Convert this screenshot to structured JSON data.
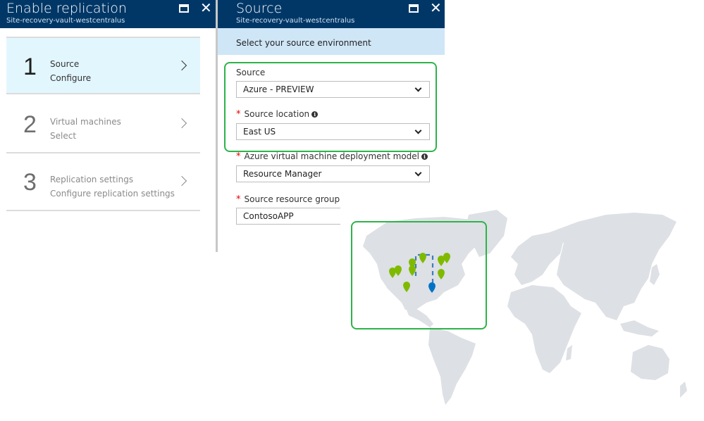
{
  "left_blade": {
    "title": "Enable replication",
    "subtitle": "Site-recovery-vault-westcentralus",
    "steps": [
      {
        "number": "1",
        "title": "Source",
        "subtitle": "Configure",
        "state": "active"
      },
      {
        "number": "2",
        "title": "Virtual machines",
        "subtitle": "Select",
        "state": "inactive"
      },
      {
        "number": "3",
        "title": "Replication settings",
        "subtitle": "Configure replication settings",
        "state": "inactive"
      }
    ]
  },
  "right_blade": {
    "title": "Source",
    "subtitle": "Site-recovery-vault-westcentralus",
    "info_bar": "Select your source environment",
    "fields": {
      "source": {
        "label": "Source",
        "value": "Azure - PREVIEW",
        "required": false
      },
      "source_location": {
        "label": "Source location",
        "value": "East US",
        "required": true
      },
      "deployment_model": {
        "label": "Azure virtual machine deployment model",
        "value": "Resource Manager",
        "required": true
      },
      "resource_group": {
        "label": "Source resource group",
        "value": "ContosoAPP",
        "required": true
      }
    }
  },
  "icons": {
    "maximize": "maximize-icon",
    "close": "close-icon",
    "chevron": "chevron-right-icon",
    "caret": "chevron-down-icon",
    "info": "info-icon",
    "required": "*",
    "close_glyph": "✕",
    "info_glyph": "i"
  },
  "map": {
    "description": "World map with Azure region pins",
    "selected_region_color": "#0072c6",
    "other_region_color": "#7fba00",
    "highlight_color": "#2db34a"
  }
}
